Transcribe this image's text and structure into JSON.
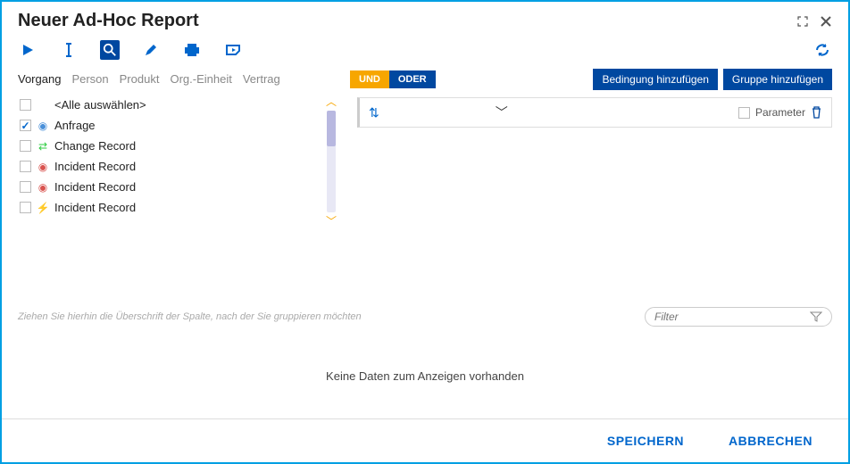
{
  "header": {
    "title": "Neuer Ad-Hoc Report"
  },
  "tabs": [
    {
      "label": "Vorgang",
      "active": true
    },
    {
      "label": "Person",
      "active": false
    },
    {
      "label": "Produkt",
      "active": false
    },
    {
      "label": "Org.-Einheit",
      "active": false
    },
    {
      "label": "Vertrag",
      "active": false
    }
  ],
  "list": {
    "selectAll": "<Alle auswählen>",
    "items": [
      {
        "label": "Anfrage",
        "checked": true,
        "iconColor": "#4a90d9"
      },
      {
        "label": "Change Record",
        "checked": false,
        "iconColor": "#2ecc40"
      },
      {
        "label": "Incident Record",
        "checked": false,
        "iconColor": "#d9534f"
      },
      {
        "label": "Incident Record",
        "checked": false,
        "iconColor": "#d9534f"
      },
      {
        "label": "Incident Record",
        "checked": false,
        "iconColor": "#333"
      }
    ]
  },
  "conditions": {
    "und": "UND",
    "oder": "ODER",
    "addCondition": "Bedingung hinzufügen",
    "addGroup": "Gruppe hinzufügen",
    "parameterLabel": "Parameter"
  },
  "grid": {
    "groupHint": "Ziehen Sie hierhin die Überschrift der Spalte, nach der Sie gruppieren möchten",
    "filterPlaceholder": "Filter",
    "noData": "Keine Daten zum Anzeigen vorhanden"
  },
  "footer": {
    "save": "SPEICHERN",
    "cancel": "ABBRECHEN"
  }
}
